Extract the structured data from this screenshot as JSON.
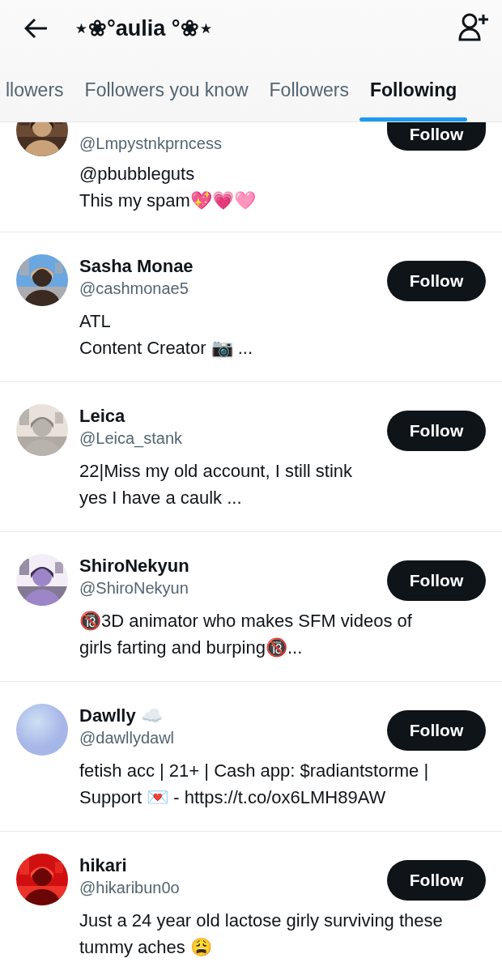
{
  "header": {
    "title": "⋆❀°aulia °❀⋆"
  },
  "tabs": [
    {
      "label": "llowers",
      "selected": false
    },
    {
      "label": "Followers you know",
      "selected": false
    },
    {
      "label": "Followers",
      "selected": false
    },
    {
      "label": "Following",
      "selected": true
    }
  ],
  "users": [
    {
      "handle": "@Lmpystnkprncess",
      "bio": [
        "@pbubbleguts",
        "This my spam💖💗🩷"
      ],
      "button": "Follow"
    },
    {
      "name": "Sasha Monae",
      "handle": "@cashmonae5",
      "bio": [
        "ATL",
        "Content Creator 📷 ..."
      ],
      "button": "Follow"
    },
    {
      "name": "Leica",
      "handle": "@Leica_stank",
      "bio": [
        "22|Miss my old account, I still stink",
        "yes I have a caulk ..."
      ],
      "button": "Follow"
    },
    {
      "name": "ShiroNekyun",
      "handle": "@ShiroNekyun",
      "bio": [
        "🔞3D animator who makes SFM videos of",
        "girls farting and burping🔞..."
      ],
      "button": "Follow"
    },
    {
      "name": "Dawlly ☁️",
      "handle": "@dawllydawl",
      "bio": [
        "fetish acc | 21+ | Cash app: $radiantstorme |",
        "Support 💌 - https://t.co/ox6LMH89AW"
      ],
      "button": "Follow",
      "avatar": {
        "kind": "plain"
      }
    },
    {
      "name": "hikari",
      "handle": "@hikaribun0o",
      "bio": [
        "Just a 24 year old lactose girly surviving these",
        "tummy aches 😩"
      ],
      "button": "Follow"
    }
  ]
}
